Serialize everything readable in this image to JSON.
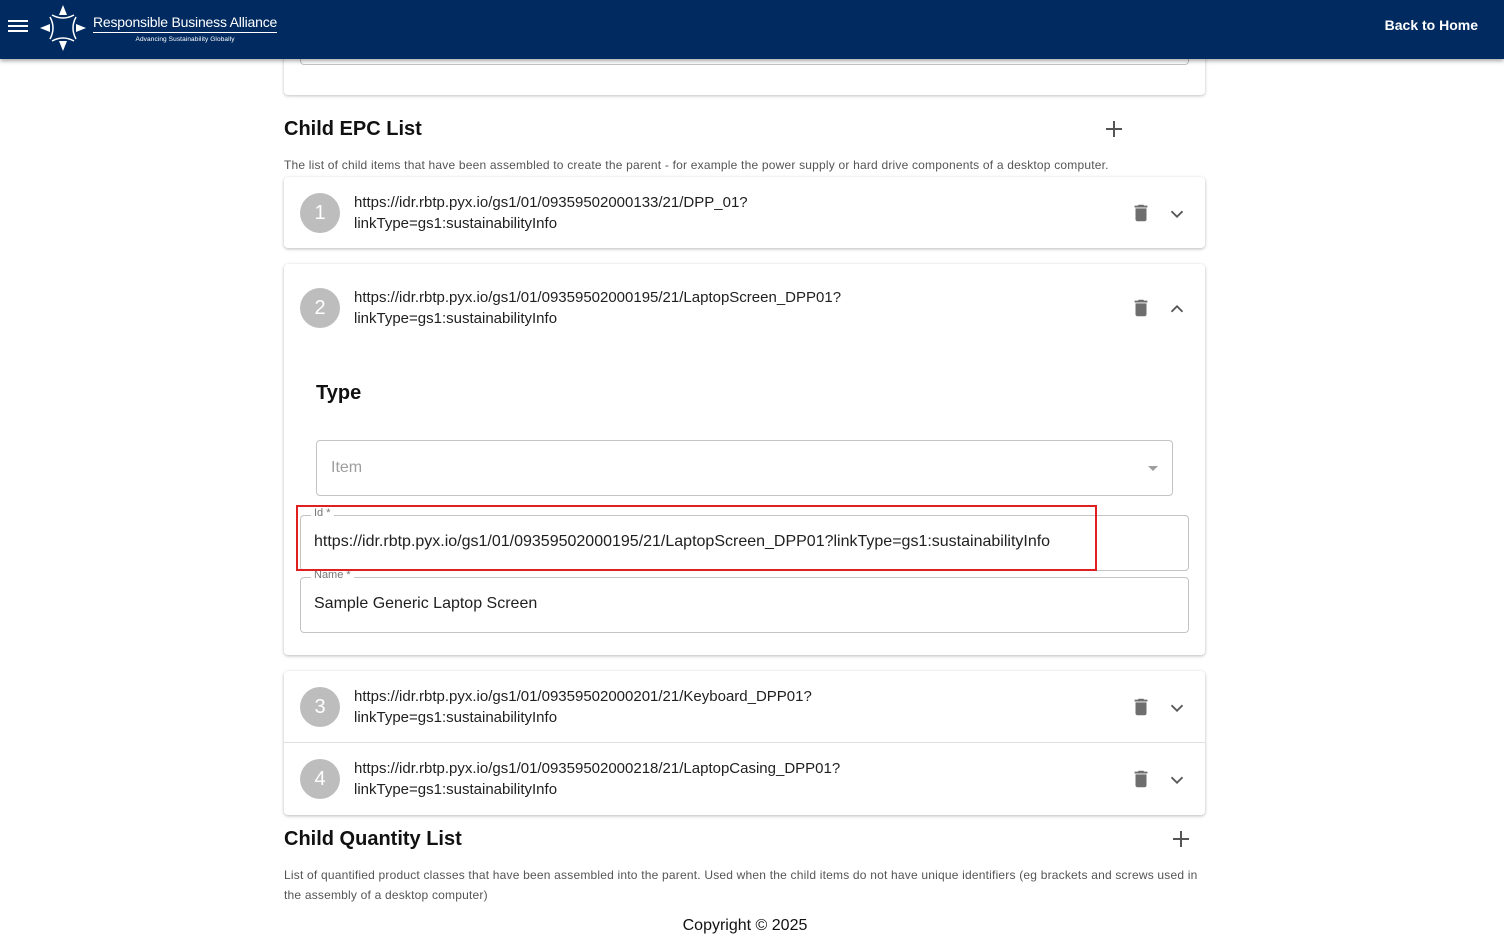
{
  "header": {
    "brand_name": "Responsible Business Alliance",
    "brand_tagline": "Advancing Sustainability Globally",
    "back_home": "Back to Home"
  },
  "child_epc": {
    "title": "Child EPC List",
    "description": "The list of child items that have been assembled to create the parent - for example the power supply or hard drive components of a desktop computer.",
    "items": [
      {
        "number": "1",
        "url_line1": "https://idr.rbtp.pyx.io/gs1/01/09359502000133/21/DPP_01?",
        "url_line2": "linkType=gs1:sustainabilityInfo"
      },
      {
        "number": "2",
        "url_line1": "https://idr.rbtp.pyx.io/gs1/01/09359502000195/21/LaptopScreen_DPP01?",
        "url_line2": "linkType=gs1:sustainabilityInfo"
      },
      {
        "number": "3",
        "url_line1": "https://idr.rbtp.pyx.io/gs1/01/09359502000201/21/Keyboard_DPP01?",
        "url_line2": "linkType=gs1:sustainabilityInfo"
      },
      {
        "number": "4",
        "url_line1": "https://idr.rbtp.pyx.io/gs1/01/09359502000218/21/LaptopCasing_DPP01?",
        "url_line2": "linkType=gs1:sustainabilityInfo"
      }
    ],
    "expanded": {
      "type_label": "Type",
      "type_select_value": "Item",
      "id_label": "Id *",
      "id_value": "https://idr.rbtp.pyx.io/gs1/01/09359502000195/21/LaptopScreen_DPP01?linkType=gs1:sustainabilityInfo",
      "name_label": "Name *",
      "name_value": "Sample Generic Laptop Screen"
    }
  },
  "child_quantity": {
    "title": "Child Quantity List",
    "description": "List of quantified product classes that have been assembled into the parent. Used when the child items do not have unique identifiers (eg brackets and screws used in the assembly of a desktop computer)"
  },
  "footer": {
    "copyright": "Copyright © 2025"
  },
  "colors": {
    "header_bg": "#012b60",
    "highlight": "#e02020",
    "badge": "#bdbdbd"
  }
}
